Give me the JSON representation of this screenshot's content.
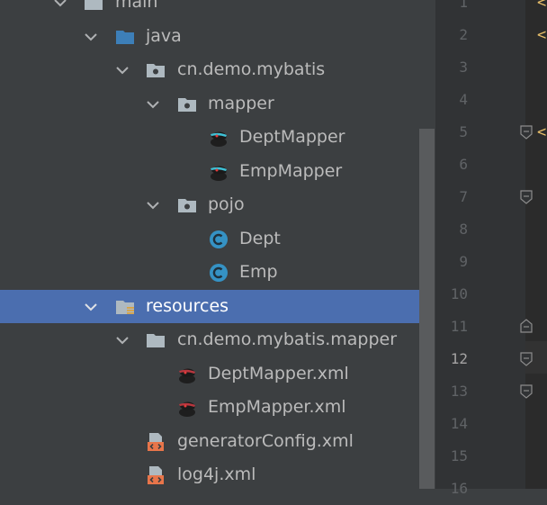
{
  "tree": {
    "items": [
      {
        "label": "main",
        "icon": "folder-icon"
      },
      {
        "label": "java",
        "icon": "source-folder-icon"
      },
      {
        "label": "cn.demo.mybatis",
        "icon": "package-icon"
      },
      {
        "label": "mapper",
        "icon": "package-icon"
      },
      {
        "label": "DeptMapper",
        "icon": "mybatis-mapper-icon"
      },
      {
        "label": "EmpMapper",
        "icon": "mybatis-mapper-icon"
      },
      {
        "label": "pojo",
        "icon": "package-icon"
      },
      {
        "label": "Dept",
        "icon": "class-icon"
      },
      {
        "label": "Emp",
        "icon": "class-icon"
      },
      {
        "label": "resources",
        "icon": "resources-folder-icon"
      },
      {
        "label": "cn.demo.mybatis.mapper",
        "icon": "folder-icon"
      },
      {
        "label": "DeptMapper.xml",
        "icon": "mybatis-xml-icon"
      },
      {
        "label": "EmpMapper.xml",
        "icon": "mybatis-xml-icon"
      },
      {
        "label": "generatorConfig.xml",
        "icon": "xml-file-icon"
      },
      {
        "label": "log4j.xml",
        "icon": "xml-file-icon"
      }
    ],
    "selected_index": 9
  },
  "editor": {
    "line_numbers": [
      "1",
      "2",
      "3",
      "4",
      "5",
      "6",
      "7",
      "8",
      "9",
      "10",
      "11",
      "12",
      "13",
      "14",
      "15",
      "16"
    ],
    "current_line": "12",
    "code_fragments": [
      {
        "line": 1,
        "text": "<"
      },
      {
        "line": 2,
        "text": "<"
      },
      {
        "line": 5,
        "text": "<"
      }
    ]
  },
  "colors": {
    "selection": "#4b6eaf",
    "folder_blue": "#3d7fb8",
    "folder_gray": "#aeb9c0",
    "class_circle": "#3592c4",
    "xml_orange": "#e8754a"
  }
}
